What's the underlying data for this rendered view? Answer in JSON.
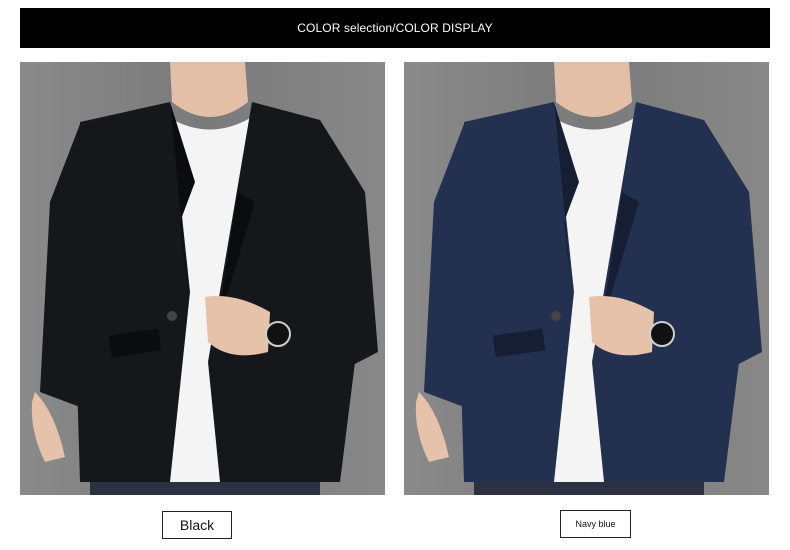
{
  "banner": {
    "title": "COLOR selection/COLOR DISPLAY"
  },
  "variants": [
    {
      "label": "Black",
      "blazer_color": "#16171b",
      "shade_color": "#0b0c0f"
    },
    {
      "label": "Navy blue",
      "blazer_color": "#24304f",
      "shade_color": "#161e33"
    }
  ],
  "colors": {
    "banner_bg": "#000000",
    "photo_bg": "#808080",
    "shirt": "#f4f4f4",
    "skin": "#e6c2ab",
    "jeans": "#2b3140"
  }
}
